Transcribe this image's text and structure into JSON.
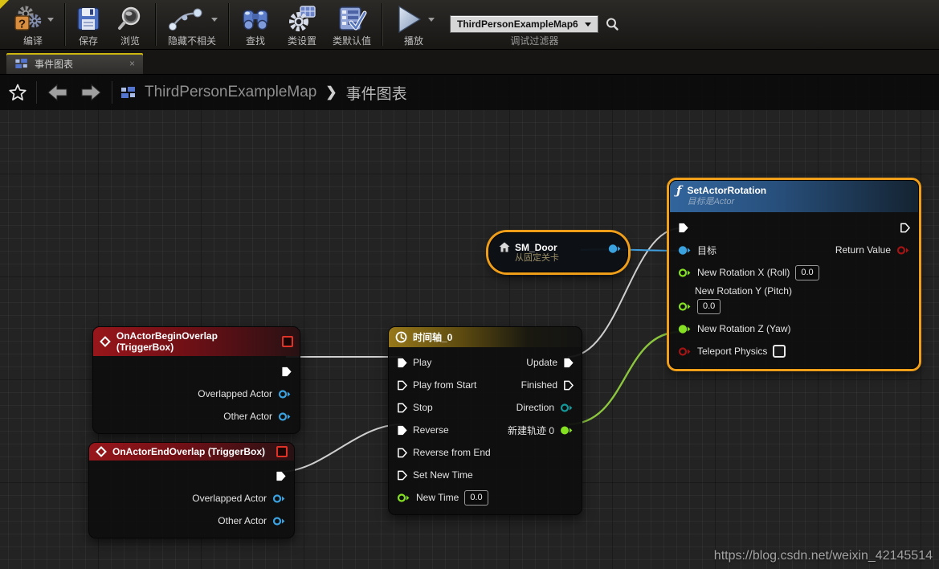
{
  "toolbar": {
    "buttons": [
      {
        "label": "编译",
        "icon": "compile-icon",
        "has_dropdown": true
      },
      {
        "label": "保存",
        "icon": "save-icon",
        "has_dropdown": false
      },
      {
        "label": "浏览",
        "icon": "browse-icon",
        "has_dropdown": false
      },
      {
        "label": "隐藏不相关",
        "icon": "hide-unrelated-icon",
        "has_dropdown": true
      },
      {
        "label": "查找",
        "icon": "find-icon",
        "has_dropdown": false
      },
      {
        "label": "类设置",
        "icon": "class-settings-icon",
        "has_dropdown": false
      },
      {
        "label": "类默认值",
        "icon": "class-defaults-icon",
        "has_dropdown": false
      },
      {
        "label": "播放",
        "icon": "play-icon",
        "has_dropdown": true
      }
    ],
    "debug_filter": {
      "value": "ThirdPersonExampleMap6",
      "caption": "调试过滤器"
    }
  },
  "tab": {
    "title": "事件图表",
    "close_label": "×"
  },
  "breadcrumb": {
    "map_name": "ThirdPersonExampleMap",
    "separator": "❯",
    "graph_name": "事件图表"
  },
  "nodes": {
    "begin_overlap": {
      "title": "OnActorBeginOverlap (TriggerBox)",
      "output_pins": [
        {
          "label": "Overlapped Actor"
        },
        {
          "label": "Other Actor"
        }
      ]
    },
    "end_overlap": {
      "title": "OnActorEndOverlap (TriggerBox)",
      "output_pins": [
        {
          "label": "Overlapped Actor"
        },
        {
          "label": "Other Actor"
        }
      ]
    },
    "timeline": {
      "title": "时间轴_0",
      "rows": [
        {
          "left": "Play",
          "right": "Update"
        },
        {
          "left": "Play from Start",
          "right": "Finished"
        },
        {
          "left": "Stop",
          "right": "Direction"
        },
        {
          "left": "Reverse",
          "right": "新建轨迹 0"
        },
        {
          "left": "Reverse from End",
          "right": ""
        },
        {
          "left": "Set New Time",
          "right": ""
        },
        {
          "left": "New Time",
          "right": "",
          "value": "0.0"
        }
      ]
    },
    "sm_door": {
      "title": "SM_Door",
      "subtitle": "从固定关卡"
    },
    "set_actor_rotation": {
      "title": "SetActorRotation",
      "subtitle": "目标是Actor",
      "pins": {
        "target": "目标",
        "return_value": "Return Value",
        "roll": "New Rotation X (Roll)",
        "roll_value": "0.0",
        "pitch": "New Rotation Y (Pitch)",
        "pitch_value": "0.0",
        "yaw": "New Rotation Z (Yaw)",
        "teleport": "Teleport Physics"
      }
    }
  },
  "watermark": "https://blog.csdn.net/weixin_42145514",
  "colors": {
    "selection": "#ef9e1a",
    "exec_wire": "#cfcfcf",
    "green_wire": "#8cc63f",
    "blue_wire": "#3f9fdf",
    "event_header": "#97161b",
    "function_header": "#32659d",
    "timeline_header": "#97781a"
  }
}
